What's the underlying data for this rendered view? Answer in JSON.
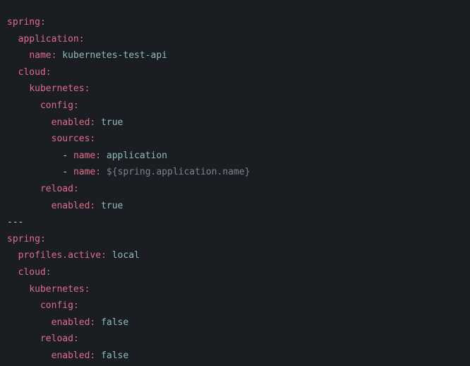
{
  "lines": [
    {
      "indent": 0,
      "key": "spring:",
      "value": null
    },
    {
      "indent": 1,
      "key": "application:",
      "value": null
    },
    {
      "indent": 2,
      "key": "name:",
      "value": "kubernetes-test-api"
    },
    {
      "indent": 1,
      "key": "cloud:",
      "value": null
    },
    {
      "indent": 2,
      "key": "kubernetes:",
      "value": null
    },
    {
      "indent": 3,
      "key": "config:",
      "value": null
    },
    {
      "indent": 4,
      "key": "enabled:",
      "value": "true"
    },
    {
      "indent": 4,
      "key": "sources:",
      "value": null
    },
    {
      "indent": 5,
      "dash": "- ",
      "key": "name:",
      "value": "application"
    },
    {
      "indent": 5,
      "dash": "- ",
      "key": "name:",
      "placeholder": "${spring.application.name}"
    },
    {
      "indent": 3,
      "key": "reload:",
      "value": null
    },
    {
      "indent": 4,
      "key": "enabled:",
      "value": "true"
    },
    {
      "separator": "---"
    },
    {
      "indent": 0,
      "key": "spring:",
      "value": null
    },
    {
      "indent": 1,
      "key": "profiles.active:",
      "value": "local"
    },
    {
      "indent": 1,
      "key": "cloud:",
      "value": null
    },
    {
      "indent": 2,
      "key": "kubernetes:",
      "value": null
    },
    {
      "indent": 3,
      "key": "config:",
      "value": null
    },
    {
      "indent": 4,
      "key": "enabled:",
      "value": "false"
    },
    {
      "indent": 3,
      "key": "reload:",
      "value": null
    },
    {
      "indent": 4,
      "key": "enabled:",
      "value": "false"
    }
  ],
  "indent_unit": "  "
}
